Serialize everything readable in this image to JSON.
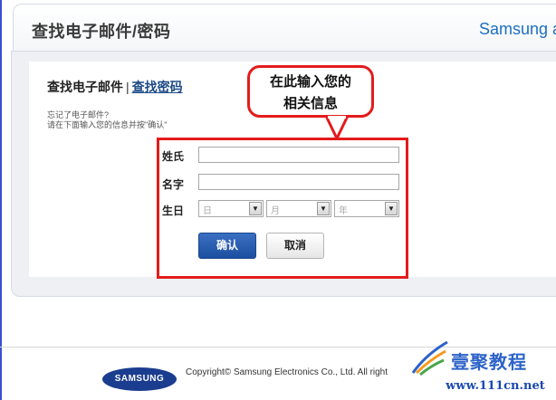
{
  "header": {
    "title": "查找电子邮件/密码",
    "brand": "Samsung account"
  },
  "tabs": {
    "active_label": "查找电子邮件",
    "separator": "|",
    "link_label": "查找密码"
  },
  "description": {
    "line1": "忘记了电子邮件?",
    "line2": "请在下面输入您的信息并按\"确认\""
  },
  "form": {
    "last_name_label": "姓氏",
    "last_name_value": "",
    "first_name_label": "名字",
    "first_name_value": "",
    "birthday_label": "生日",
    "day_select": "日",
    "month_select": "月",
    "year_select": "年",
    "confirm_label": "确认",
    "cancel_label": "取消"
  },
  "callout": {
    "line1": "在此输入您的",
    "line2": "相关信息"
  },
  "footer": {
    "logo_text": "SAMSUNG",
    "copyright": "Copyright© Samsung Electronics Co., Ltd. All right"
  },
  "watermark": {
    "name": "壹聚教程",
    "domain": "www.111cn.net"
  },
  "colors": {
    "highlight": "#e41b1b",
    "primary_button": "#1c4f9f",
    "brand_blue": "#1c6fbf",
    "link": "#1d4a86"
  }
}
